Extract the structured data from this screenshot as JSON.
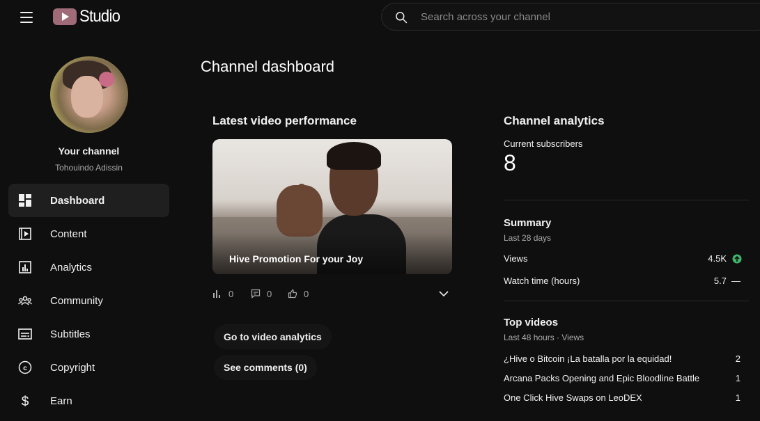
{
  "header": {
    "logo_text": "Studio",
    "search_placeholder": "Search across your channel"
  },
  "sidebar": {
    "channel_title": "Your channel",
    "channel_name": "Tohouindo Adissin",
    "items": [
      {
        "label": "Dashboard",
        "icon": "dashboard-icon",
        "active": true
      },
      {
        "label": "Content",
        "icon": "content-icon"
      },
      {
        "label": "Analytics",
        "icon": "analytics-icon"
      },
      {
        "label": "Community",
        "icon": "community-icon"
      },
      {
        "label": "Subtitles",
        "icon": "subtitles-icon"
      },
      {
        "label": "Copyright",
        "icon": "copyright-icon"
      },
      {
        "label": "Earn",
        "icon": "dollar-icon"
      }
    ]
  },
  "main": {
    "page_title": "Channel dashboard",
    "latest": {
      "title": "Latest video performance",
      "video_title": "Hive Promotion For your Joy",
      "views": "0",
      "comments": "0",
      "likes": "0",
      "go_to_analytics": "Go to video analytics",
      "see_comments": "See comments (0)"
    },
    "analytics": {
      "title": "Channel analytics",
      "subscribers_label": "Current subscribers",
      "subscribers": "8",
      "summary_title": "Summary",
      "summary_period": "Last 28 days",
      "views_label": "Views",
      "views_value": "4.5K",
      "views_trend": "up",
      "watch_label": "Watch time (hours)",
      "watch_value": "5.7",
      "watch_trend": "—",
      "top_title": "Top videos",
      "top_period": "Last 48 hours · Views",
      "top_videos": [
        {
          "title": "¿Hive o Bitcoin ¡La batalla por la equidad!",
          "views": "2"
        },
        {
          "title": "Arcana Packs Opening and Epic Bloodline Battle",
          "views": "1"
        },
        {
          "title": "One Click Hive Swaps on LeoDEX",
          "views": "1"
        }
      ]
    }
  },
  "colors": {
    "background": "#0f0f0f",
    "active_nav": "#1f1f1f",
    "trend_up": "#41b36b",
    "logo": "#a06b78"
  }
}
